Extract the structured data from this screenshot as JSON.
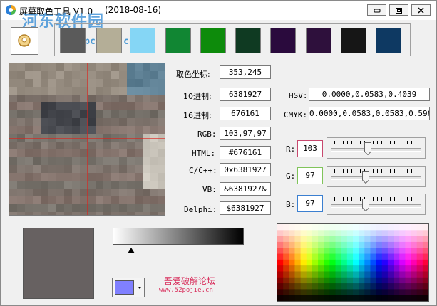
{
  "window": {
    "title": "屏幕取色工具 V1.0",
    "date": "(2018-08-16)"
  },
  "watermark": {
    "site_name": "河东软件园",
    "url": "www.pc0359.cn"
  },
  "swatches": [
    "#5a5a5a",
    "#b4ae97",
    "#85d6f5",
    "#118633",
    "#0d8b0b",
    "#0f3a22",
    "#2a0a3d",
    "#2e103c",
    "#161616",
    "#0e3962"
  ],
  "fields": {
    "coord": {
      "label": "取色坐标:",
      "value": "353,245"
    },
    "dec": {
      "label": "10进制:",
      "value": "6381927"
    },
    "hex": {
      "label": "16进制:",
      "value": "676161"
    },
    "rgb": {
      "label": "RGB:",
      "value": "103,97,97"
    },
    "html": {
      "label": "HTML:",
      "value": "#676161"
    },
    "cpp": {
      "label": "C/C++:",
      "value": "0x6381927"
    },
    "vb": {
      "label": "VB:",
      "value": "&6381927&"
    },
    "delphi": {
      "label": "Delphi:",
      "value": "$6381927"
    },
    "hsv": {
      "label": "HSV:",
      "value": "0.0000,0.0583,0.4039"
    },
    "cmyk": {
      "label": "CMYK:",
      "value": "0.0000,0.0583,0.0583,0.5961"
    }
  },
  "channels": {
    "r": {
      "label": "R:",
      "value": "103",
      "level": 0.404,
      "color": "#c8486e"
    },
    "g": {
      "label": "G:",
      "value": "97",
      "level": 0.38,
      "color": "#80c45a"
    },
    "b": {
      "label": "B:",
      "value": "97",
      "level": 0.38,
      "color": "#3b7fd0"
    }
  },
  "current_color": "#676161",
  "picker_color": "#8080ff",
  "credits": {
    "line1": "吾爱破解论坛",
    "line2": "www.52pojie.cn"
  }
}
